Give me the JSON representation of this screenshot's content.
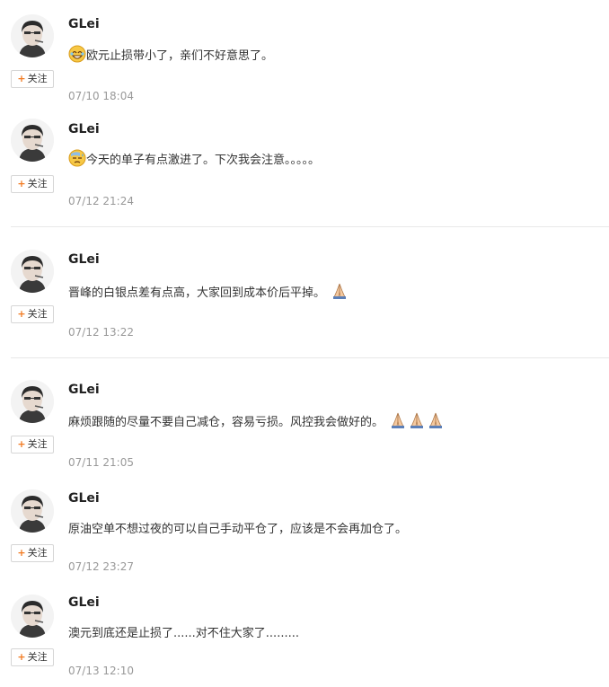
{
  "follow_label": "关注",
  "posts": [
    {
      "name": "GLei",
      "text": "欧元止损带小了，亲们不好意思了。",
      "time": "07/10 18:04",
      "lead_emoji": "laugh-sweat-icon",
      "trail_emoji": []
    },
    {
      "name": "GLei",
      "text": "今天的单子有点激进了。下次我会注意。。。。。",
      "time": "07/12 21:24",
      "lead_emoji": "sweat-face-icon",
      "trail_emoji": []
    },
    {
      "name": "GLei",
      "text": "晋峰的白银点差有点高，大家回到成本价后平掉。",
      "time": "07/12 13:22",
      "lead_emoji": "",
      "trail_emoji": [
        "pray-icon"
      ]
    },
    {
      "name": "GLei",
      "text": "麻烦跟随的尽量不要自己减仓，容易亏损。风控我会做好的。",
      "time": "07/11 21:05",
      "lead_emoji": "",
      "trail_emoji": [
        "pray-icon",
        "pray-icon",
        "pray-icon"
      ]
    },
    {
      "name": "GLei",
      "text": "原油空单不想过夜的可以自己手动平仓了，应该是不会再加仓了。",
      "time": "07/12 23:27",
      "lead_emoji": "",
      "trail_emoji": []
    },
    {
      "name": "GLei",
      "text": "澳元到底还是止损了......对不住大家了.........",
      "time": "07/13 12:10",
      "lead_emoji": "",
      "trail_emoji": []
    }
  ]
}
